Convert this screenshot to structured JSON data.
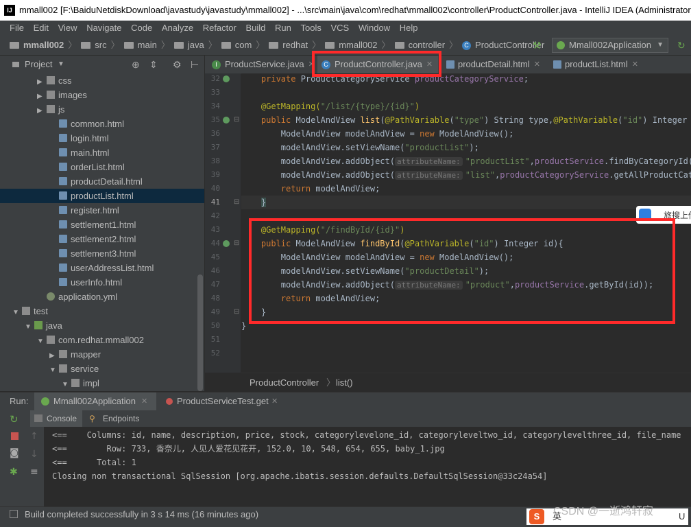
{
  "title_bar": {
    "logo": "IJ",
    "text": "mmall002 [F:\\BaiduNetdiskDownload\\javastudy\\javastudy\\mmall002] - ...\\src\\main\\java\\com\\redhat\\mmall002\\controller\\ProductController.java - IntelliJ IDEA (Administrator)"
  },
  "menu": [
    "File",
    "Edit",
    "View",
    "Navigate",
    "Code",
    "Analyze",
    "Refactor",
    "Build",
    "Run",
    "Tools",
    "VCS",
    "Window",
    "Help"
  ],
  "breadcrumb": [
    "mmall002",
    "src",
    "main",
    "java",
    "com",
    "redhat",
    "mmall002",
    "controller",
    "ProductController"
  ],
  "run_config": "Mmall002Application",
  "project_panel": {
    "title": "Project"
  },
  "tree": [
    {
      "label": "css",
      "depth": 3,
      "type": "folder",
      "arrow": "▶"
    },
    {
      "label": "images",
      "depth": 3,
      "type": "folder",
      "arrow": "▶"
    },
    {
      "label": "js",
      "depth": 3,
      "type": "folder",
      "arrow": "▶"
    },
    {
      "label": "common.html",
      "depth": 4,
      "type": "html",
      "arrow": ""
    },
    {
      "label": "login.html",
      "depth": 4,
      "type": "html",
      "arrow": ""
    },
    {
      "label": "main.html",
      "depth": 4,
      "type": "html",
      "arrow": ""
    },
    {
      "label": "orderList.html",
      "depth": 4,
      "type": "html",
      "arrow": ""
    },
    {
      "label": "productDetail.html",
      "depth": 4,
      "type": "html",
      "arrow": ""
    },
    {
      "label": "productList.html",
      "depth": 4,
      "type": "html",
      "arrow": "",
      "selected": true
    },
    {
      "label": "register.html",
      "depth": 4,
      "type": "html",
      "arrow": ""
    },
    {
      "label": "settlement1.html",
      "depth": 4,
      "type": "html",
      "arrow": ""
    },
    {
      "label": "settlement2.html",
      "depth": 4,
      "type": "html",
      "arrow": ""
    },
    {
      "label": "settlement3.html",
      "depth": 4,
      "type": "html",
      "arrow": ""
    },
    {
      "label": "userAddressList.html",
      "depth": 4,
      "type": "html",
      "arrow": ""
    },
    {
      "label": "userInfo.html",
      "depth": 4,
      "type": "html",
      "arrow": ""
    },
    {
      "label": "application.yml",
      "depth": 3,
      "type": "yml",
      "arrow": ""
    },
    {
      "label": "test",
      "depth": 1,
      "type": "folder",
      "arrow": "▼"
    },
    {
      "label": "java",
      "depth": 2,
      "type": "folder-g",
      "arrow": "▼"
    },
    {
      "label": "com.redhat.mmall002",
      "depth": 3,
      "type": "pkg",
      "arrow": "▼"
    },
    {
      "label": "mapper",
      "depth": 4,
      "type": "pkg",
      "arrow": "▶"
    },
    {
      "label": "service",
      "depth": 4,
      "type": "pkg",
      "arrow": "▼"
    },
    {
      "label": "impl",
      "depth": 5,
      "type": "pkg",
      "arrow": "▼"
    }
  ],
  "tabs": [
    {
      "label": "ProductService.java",
      "icon": "I",
      "icon_color": "#4a8a4a"
    },
    {
      "label": "ProductController.java",
      "icon": "C",
      "icon_color": "#3a7fbe",
      "active": true
    },
    {
      "label": "productDetail.html",
      "icon": "",
      "icon_color": "#6e8fb0"
    },
    {
      "label": "productList.html",
      "icon": "",
      "icon_color": "#6e8fb0"
    }
  ],
  "line_numbers": [
    "32",
    "33",
    "34",
    "35",
    "36",
    "37",
    "38",
    "39",
    "40",
    "41",
    "42",
    "43",
    "44",
    "45",
    "46",
    "47",
    "48",
    "49",
    "50",
    "51",
    "52"
  ],
  "current_line": "41",
  "code": {
    "l32": {
      "kw": "private ",
      "type": "ProductCategoryService ",
      "field": "productCategoryService",
      "end": ";"
    },
    "l34": {
      "ann": "@GetMapping(",
      "str": "\"/list/{type}/{id}\"",
      "end": ")"
    },
    "l35": {
      "kw": "public ",
      "type": "ModelAndView ",
      "fn": "list",
      "p1": "(",
      "ann1": "@PathVariable",
      "a1": "(",
      "s1": "\"type\"",
      "r1": ") String type,",
      "ann2": "@PathVariable",
      "a2": "(",
      "s2": "\"id\"",
      "r2": ") Integer id){"
    },
    "l36": {
      "a": "ModelAndView modelAndView = ",
      "kw": "new ",
      "b": "ModelAndView();"
    },
    "l37": {
      "a": "modelAndView.setViewName(",
      "s": "\"productList\"",
      "b": ");"
    },
    "l38": {
      "a": "modelAndView.addObject(",
      "hint": "attributeName:",
      "s": "\"productList\"",
      "b": ",",
      "f": "productService",
      "c": ".findByCategoryId(type,id));"
    },
    "l39": {
      "a": "modelAndView.addObject(",
      "hint": "attributeName:",
      "s": "\"list\"",
      "b": ",",
      "f": "productCategoryService",
      "c": ".getAllProductCategoryVO());"
    },
    "l40": {
      "kw": "return ",
      "a": "modelAndView;"
    },
    "l41": {
      "a": "}"
    },
    "l43": {
      "ann": "@GetMapping(",
      "str": "\"/findById/{id}\"",
      "end": ")"
    },
    "l44": {
      "kw": "public ",
      "type": "ModelAndView ",
      "fn": "findById",
      "p1": "(",
      "ann1": "@PathVariable",
      "a1": "(",
      "s1": "\"id\"",
      "r1": ") Integer id){"
    },
    "l45": {
      "a": "ModelAndView modelAndView = ",
      "kw": "new ",
      "b": "ModelAndView();"
    },
    "l46": {
      "a": "modelAndView.setViewName(",
      "s": "\"productDetail\"",
      "b": ");"
    },
    "l47": {
      "a": "modelAndView.addObject(",
      "hint": "attributeName:",
      "s": "\"product\"",
      "b": ",",
      "f": "productService",
      "c": ".getById(id));"
    },
    "l48": {
      "kw": "return ",
      "a": "modelAndView;"
    },
    "l49": {
      "a": "}"
    },
    "l50": {
      "a": "}"
    }
  },
  "editor_breadcrumb": [
    "ProductController",
    "list()"
  ],
  "overlay_label": "旅搜上传",
  "run_panel": {
    "label": "Run:",
    "tabs": [
      "Mmall002Application",
      "ProductServiceTest.get"
    ],
    "subtabs": [
      "Console",
      "Endpoints"
    ]
  },
  "console": [
    "<==    Columns: id, name, description, price, stock, categorylevelone_id, categoryleveltwo_id, categorylevelthree_id, file_name",
    "<==        Row: 733, 香奈儿, 人见人爱花见花开, 152.0, 10, 548, 654, 655, baby_1.jpg",
    "<==      Total: 1",
    "Closing non transactional SqlSession [org.apache.ibatis.session.defaults.DefaultSqlSession@33c24a54]"
  ],
  "status_text": "Build completed successfully in 3 s 14 ms (16 minutes ago)",
  "watermark": "CSDN @一逝鸿轩寂",
  "ime": {
    "s": "S",
    "lang": "英",
    "tail": "U"
  },
  "colors": {
    "highlight_box": "#ff2a2a",
    "selection": "#0d293e",
    "accent": "#3a7fbe"
  }
}
